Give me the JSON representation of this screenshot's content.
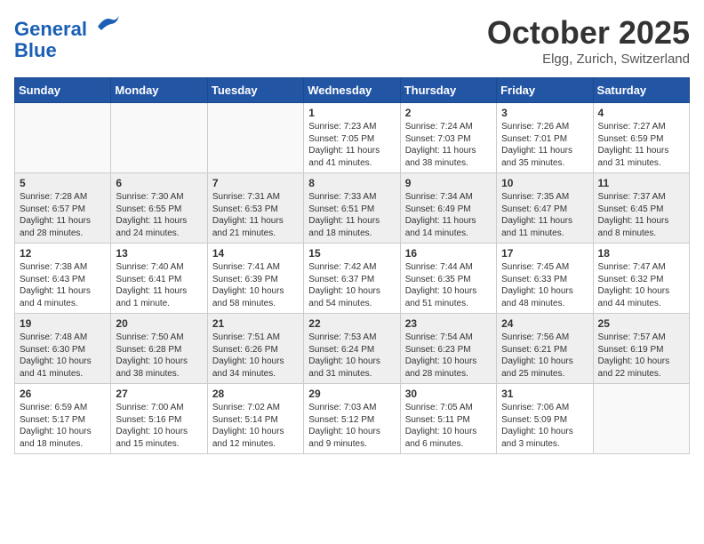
{
  "header": {
    "logo_line1": "General",
    "logo_line2": "Blue",
    "month": "October 2025",
    "location": "Elgg, Zurich, Switzerland"
  },
  "days_of_week": [
    "Sunday",
    "Monday",
    "Tuesday",
    "Wednesday",
    "Thursday",
    "Friday",
    "Saturday"
  ],
  "weeks": [
    [
      {
        "day": "",
        "content": ""
      },
      {
        "day": "",
        "content": ""
      },
      {
        "day": "",
        "content": ""
      },
      {
        "day": "1",
        "content": "Sunrise: 7:23 AM\nSunset: 7:05 PM\nDaylight: 11 hours and 41 minutes."
      },
      {
        "day": "2",
        "content": "Sunrise: 7:24 AM\nSunset: 7:03 PM\nDaylight: 11 hours and 38 minutes."
      },
      {
        "day": "3",
        "content": "Sunrise: 7:26 AM\nSunset: 7:01 PM\nDaylight: 11 hours and 35 minutes."
      },
      {
        "day": "4",
        "content": "Sunrise: 7:27 AM\nSunset: 6:59 PM\nDaylight: 11 hours and 31 minutes."
      }
    ],
    [
      {
        "day": "5",
        "content": "Sunrise: 7:28 AM\nSunset: 6:57 PM\nDaylight: 11 hours and 28 minutes."
      },
      {
        "day": "6",
        "content": "Sunrise: 7:30 AM\nSunset: 6:55 PM\nDaylight: 11 hours and 24 minutes."
      },
      {
        "day": "7",
        "content": "Sunrise: 7:31 AM\nSunset: 6:53 PM\nDaylight: 11 hours and 21 minutes."
      },
      {
        "day": "8",
        "content": "Sunrise: 7:33 AM\nSunset: 6:51 PM\nDaylight: 11 hours and 18 minutes."
      },
      {
        "day": "9",
        "content": "Sunrise: 7:34 AM\nSunset: 6:49 PM\nDaylight: 11 hours and 14 minutes."
      },
      {
        "day": "10",
        "content": "Sunrise: 7:35 AM\nSunset: 6:47 PM\nDaylight: 11 hours and 11 minutes."
      },
      {
        "day": "11",
        "content": "Sunrise: 7:37 AM\nSunset: 6:45 PM\nDaylight: 11 hours and 8 minutes."
      }
    ],
    [
      {
        "day": "12",
        "content": "Sunrise: 7:38 AM\nSunset: 6:43 PM\nDaylight: 11 hours and 4 minutes."
      },
      {
        "day": "13",
        "content": "Sunrise: 7:40 AM\nSunset: 6:41 PM\nDaylight: 11 hours and 1 minute."
      },
      {
        "day": "14",
        "content": "Sunrise: 7:41 AM\nSunset: 6:39 PM\nDaylight: 10 hours and 58 minutes."
      },
      {
        "day": "15",
        "content": "Sunrise: 7:42 AM\nSunset: 6:37 PM\nDaylight: 10 hours and 54 minutes."
      },
      {
        "day": "16",
        "content": "Sunrise: 7:44 AM\nSunset: 6:35 PM\nDaylight: 10 hours and 51 minutes."
      },
      {
        "day": "17",
        "content": "Sunrise: 7:45 AM\nSunset: 6:33 PM\nDaylight: 10 hours and 48 minutes."
      },
      {
        "day": "18",
        "content": "Sunrise: 7:47 AM\nSunset: 6:32 PM\nDaylight: 10 hours and 44 minutes."
      }
    ],
    [
      {
        "day": "19",
        "content": "Sunrise: 7:48 AM\nSunset: 6:30 PM\nDaylight: 10 hours and 41 minutes."
      },
      {
        "day": "20",
        "content": "Sunrise: 7:50 AM\nSunset: 6:28 PM\nDaylight: 10 hours and 38 minutes."
      },
      {
        "day": "21",
        "content": "Sunrise: 7:51 AM\nSunset: 6:26 PM\nDaylight: 10 hours and 34 minutes."
      },
      {
        "day": "22",
        "content": "Sunrise: 7:53 AM\nSunset: 6:24 PM\nDaylight: 10 hours and 31 minutes."
      },
      {
        "day": "23",
        "content": "Sunrise: 7:54 AM\nSunset: 6:23 PM\nDaylight: 10 hours and 28 minutes."
      },
      {
        "day": "24",
        "content": "Sunrise: 7:56 AM\nSunset: 6:21 PM\nDaylight: 10 hours and 25 minutes."
      },
      {
        "day": "25",
        "content": "Sunrise: 7:57 AM\nSunset: 6:19 PM\nDaylight: 10 hours and 22 minutes."
      }
    ],
    [
      {
        "day": "26",
        "content": "Sunrise: 6:59 AM\nSunset: 5:17 PM\nDaylight: 10 hours and 18 minutes."
      },
      {
        "day": "27",
        "content": "Sunrise: 7:00 AM\nSunset: 5:16 PM\nDaylight: 10 hours and 15 minutes."
      },
      {
        "day": "28",
        "content": "Sunrise: 7:02 AM\nSunset: 5:14 PM\nDaylight: 10 hours and 12 minutes."
      },
      {
        "day": "29",
        "content": "Sunrise: 7:03 AM\nSunset: 5:12 PM\nDaylight: 10 hours and 9 minutes."
      },
      {
        "day": "30",
        "content": "Sunrise: 7:05 AM\nSunset: 5:11 PM\nDaylight: 10 hours and 6 minutes."
      },
      {
        "day": "31",
        "content": "Sunrise: 7:06 AM\nSunset: 5:09 PM\nDaylight: 10 hours and 3 minutes."
      },
      {
        "day": "",
        "content": ""
      }
    ]
  ]
}
